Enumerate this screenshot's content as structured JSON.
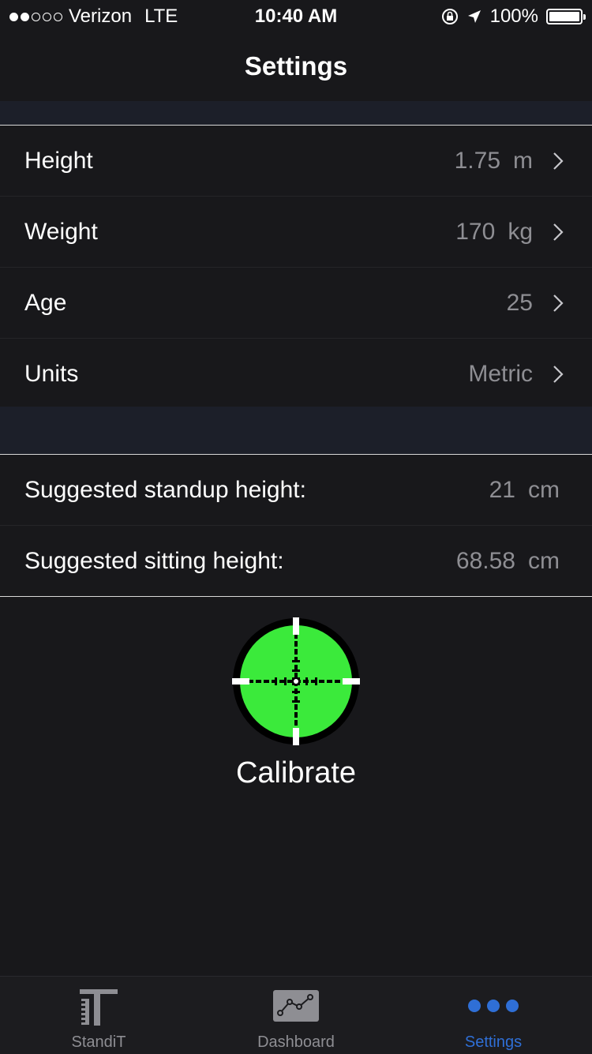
{
  "status_bar": {
    "carrier": "Verizon",
    "network": "LTE",
    "time": "10:40 AM",
    "battery": "100%",
    "signal_bars_filled": 2,
    "signal_bars_total": 5
  },
  "nav": {
    "title": "Settings"
  },
  "profile": {
    "height": {
      "label": "Height",
      "value": "1.75",
      "unit": "m"
    },
    "weight": {
      "label": "Weight",
      "value": "170",
      "unit": "kg"
    },
    "age": {
      "label": "Age",
      "value": "25"
    },
    "units": {
      "label": "Units",
      "value": "Metric"
    }
  },
  "suggestions": {
    "standup": {
      "label": "Suggested standup height:",
      "value": "21",
      "unit": "cm"
    },
    "sitting": {
      "label": "Suggested sitting height:",
      "value": "68.58",
      "unit": "cm"
    }
  },
  "calibrate": {
    "label": "Calibrate",
    "icon": "crosshair-icon",
    "color": "#3bea3b"
  },
  "tabbar": {
    "tabs": [
      {
        "label": "StandiT",
        "icon": "standit-logo-icon"
      },
      {
        "label": "Dashboard",
        "icon": "chart-icon"
      },
      {
        "label": "Settings",
        "icon": "more-dots-icon"
      }
    ],
    "active_color": "#2f6fd6",
    "inactive_color": "#8e8e93"
  }
}
